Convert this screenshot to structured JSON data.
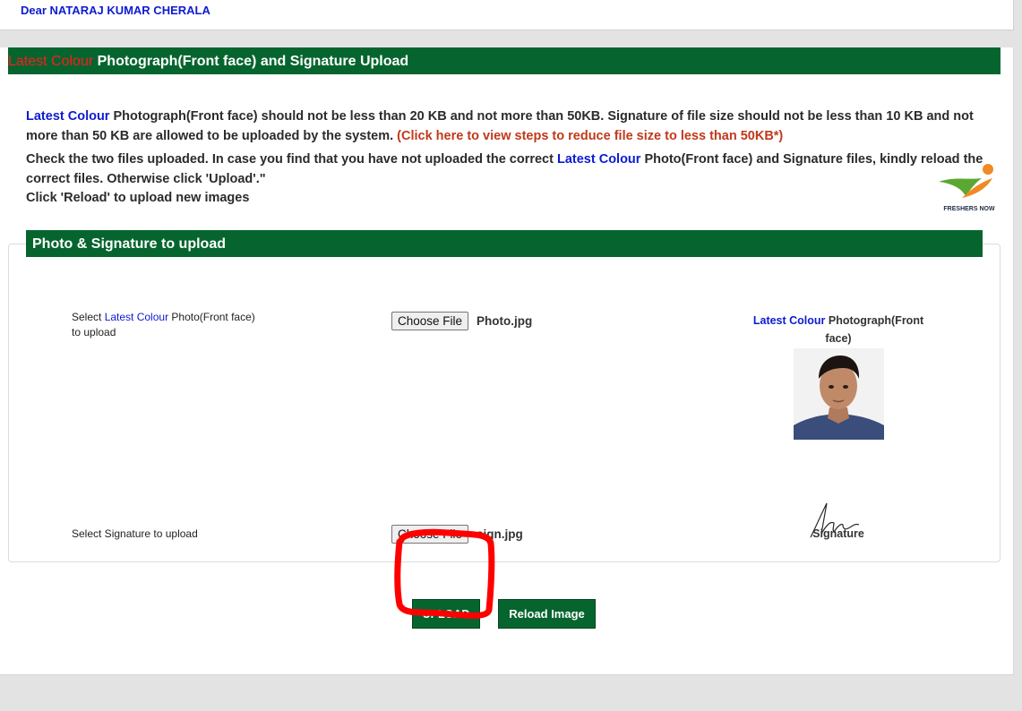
{
  "greeting": "Dear NATARAJ KUMAR CHERALA",
  "page_header": {
    "highlight": "Latest Colour",
    "title": " Photograph(Front face) and Signature Upload"
  },
  "instructions": {
    "p1_highlight": "Latest Colour",
    "p1_text": " Photograph(Front face) should not be less than 20 KB and not more than 50KB. Signature of file size should not be less than 10 KB and not more than 50 KB are allowed to be uploaded by the system. ",
    "p1_link": "(Click here to view steps to reduce file size to less than 50KB*)",
    "p2_before": "Check the two files uploaded. In case you find that you have not uploaded the correct ",
    "p2_highlight": "Latest Colour",
    "p2_after": " Photo(Front face) and Signature files, kindly reload the correct files. Otherwise click 'Upload'.\"",
    "p3": "Click 'Reload' to upload new images"
  },
  "logo": {
    "text": "FRESHERS NOW",
    "colors": {
      "orange": "#f08a24",
      "green": "#5aa832"
    }
  },
  "upload_section": {
    "title": "Photo & Signature to upload",
    "photo_row": {
      "label_before": "Select ",
      "label_highlight": "Latest Colour",
      "label_after": " Photo(Front face)",
      "label_line2": "to upload",
      "button": "Choose File",
      "filename": "Photo.jpg",
      "preview_highlight": "Latest Colour",
      "preview_title": " Photograph(Front",
      "preview_title2": "face)"
    },
    "signature_row": {
      "label": "Select Signature to upload",
      "button": "Choose File",
      "filename": "sign.jpg",
      "preview_title": "Signature"
    }
  },
  "actions": {
    "upload": "UPLOAD",
    "reload": "Reload Image"
  },
  "colors": {
    "header_green": "#06652f",
    "link_blue": "#0d1bd1",
    "accent_red": "#ff1a1a",
    "annotation_red": "#ff0000"
  }
}
